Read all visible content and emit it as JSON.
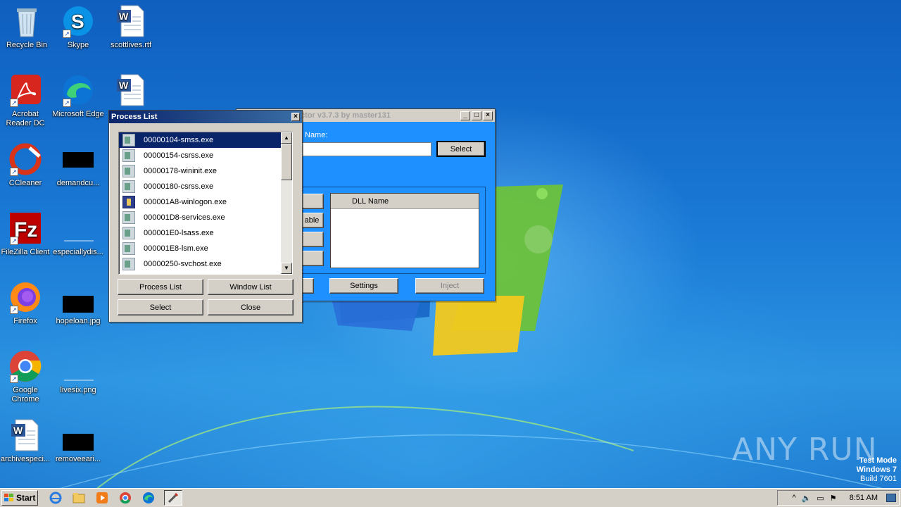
{
  "desktop": {
    "icons": [
      {
        "label": "Recycle Bin",
        "icon": "recycle-bin-icon"
      },
      {
        "label": "Skype",
        "icon": "skype-icon"
      },
      {
        "label": "scottlives.rtf",
        "icon": "word-document-icon"
      },
      {
        "label": "Acrobat Reader DC",
        "icon": "acrobat-icon"
      },
      {
        "label": "Microsoft Edge",
        "icon": "edge-icon"
      },
      {
        "label": "",
        "icon": "word-document-icon"
      },
      {
        "label": "CCleaner",
        "icon": "ccleaner-icon"
      },
      {
        "label": "demandcu...",
        "icon": "black-thumbnail-icon"
      },
      {
        "label": "FileZilla Client",
        "icon": "filezilla-icon"
      },
      {
        "label": "especiallydis...",
        "icon": "blank-file-icon"
      },
      {
        "label": "Firefox",
        "icon": "firefox-icon"
      },
      {
        "label": "hopeloan.jpg",
        "icon": "black-thumbnail-icon"
      },
      {
        "label": "Google Chrome",
        "icon": "chrome-icon"
      },
      {
        "label": "livesix.png",
        "icon": "blank-file-icon"
      },
      {
        "label": "archivespeci...",
        "icon": "word-document-icon"
      },
      {
        "label": "removeeari...",
        "icon": "black-thumbnail-icon"
      }
    ]
  },
  "injector": {
    "title": "ctor v3.7.3 by master131",
    "name_label": "Name:",
    "name_value": "",
    "select_label": "Select",
    "partial_button_label": "able",
    "dll_header": "DLL Name",
    "settings_label": "Settings",
    "inject_label": "Inject"
  },
  "process_list": {
    "title": "Process List",
    "close_glyph": "×",
    "processes": [
      {
        "name": "00000104-smss.exe",
        "selected": true,
        "icon": "process-icon"
      },
      {
        "name": "00000154-csrss.exe",
        "selected": false,
        "icon": "process-icon"
      },
      {
        "name": "00000178-wininit.exe",
        "selected": false,
        "icon": "process-icon"
      },
      {
        "name": "00000180-csrss.exe",
        "selected": false,
        "icon": "process-icon"
      },
      {
        "name": "000001A8-winlogon.exe",
        "selected": false,
        "icon": "winlogon-icon"
      },
      {
        "name": "000001D8-services.exe",
        "selected": false,
        "icon": "process-icon"
      },
      {
        "name": "000001E0-lsass.exe",
        "selected": false,
        "icon": "process-icon"
      },
      {
        "name": "000001E8-lsm.exe",
        "selected": false,
        "icon": "process-icon"
      },
      {
        "name": "00000250-svchost.exe",
        "selected": false,
        "icon": "process-icon"
      }
    ],
    "buttons": {
      "process_list": "Process List",
      "window_list": "Window List",
      "select": "Select",
      "close": "Close"
    }
  },
  "taskbar": {
    "start_label": "Start",
    "clock": "8:51 AM"
  },
  "watermark": {
    "text": "ANY RUN"
  },
  "os_info": {
    "line1": "Test Mode",
    "line2": "Windows 7",
    "line3": "Build 7601"
  }
}
